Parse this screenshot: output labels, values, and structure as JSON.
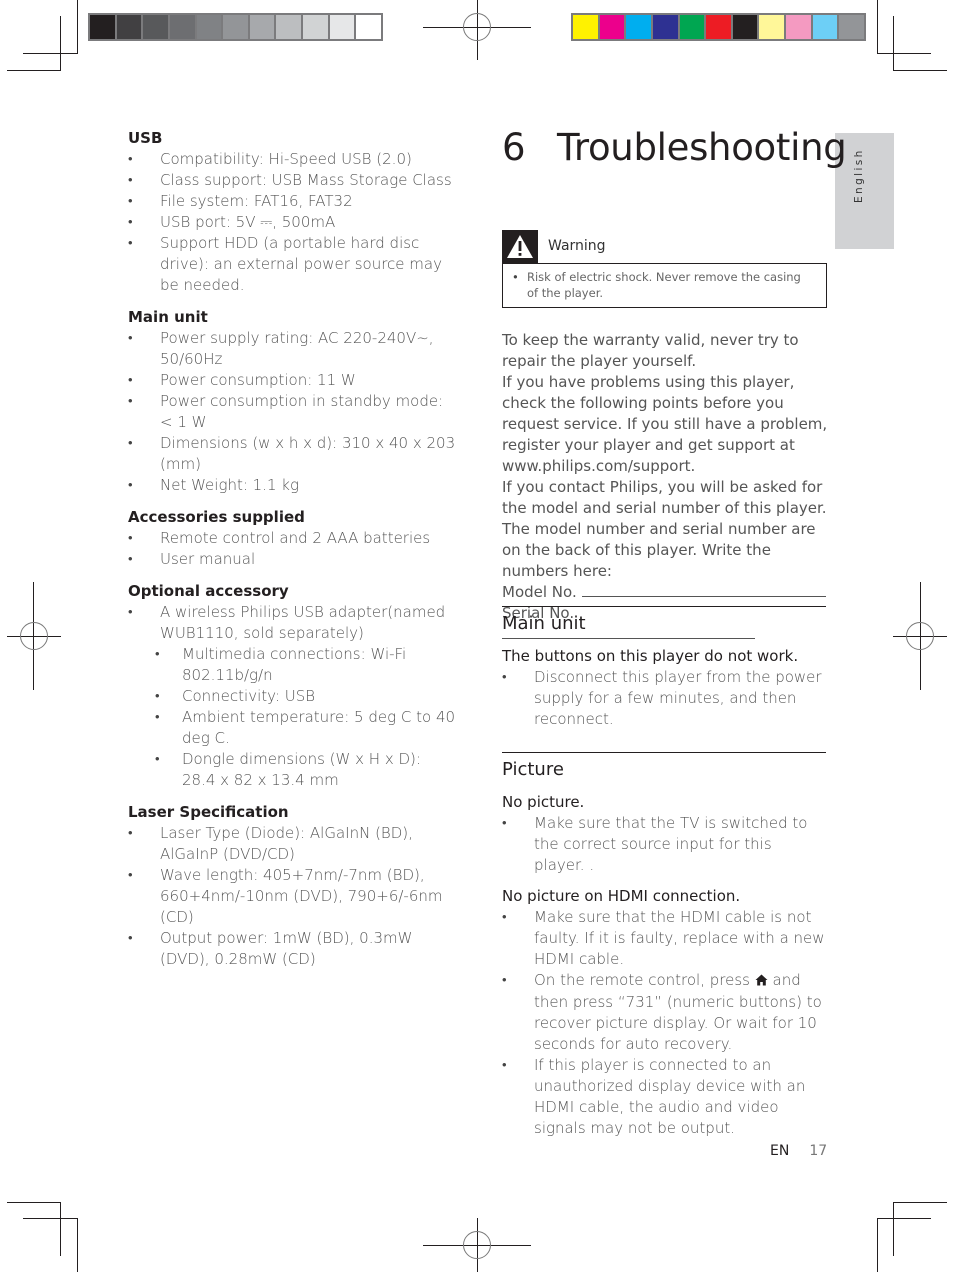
{
  "print_marks": {
    "gray_swatches": [
      "#231f20",
      "#414042",
      "#58595b",
      "#6d6e71",
      "#808285",
      "#939598",
      "#a7a9ac",
      "#bcbec0",
      "#d1d3d4",
      "#e6e7e8",
      "#ffffff"
    ],
    "color_swatches": [
      "#fff200",
      "#ec008c",
      "#00aeef",
      "#2e3192",
      "#00a651",
      "#ed1c24",
      "#231f20",
      "#fff799",
      "#f49ac1",
      "#6dcff6",
      "#939598"
    ]
  },
  "side_tab": {
    "label": "English"
  },
  "specs": {
    "usb": {
      "title": "USB",
      "items": [
        "Compatibility: Hi-Speed USB (2.0)",
        "Class support: USB Mass Storage Class",
        "File system: FAT16, FAT32",
        "USB port: 5V ⎓, 500mA",
        "Support HDD (a portable hard disc drive): an external power source may be needed."
      ]
    },
    "main_unit": {
      "title": "Main unit",
      "items": [
        "Power supply rating: AC 220-240V~, 50/60Hz",
        "Power consumption: 11 W",
        "Power consumption in standby mode: < 1 W",
        "Dimensions (w x h x d): 310 x 40 x 203 (mm)",
        "Net Weight: 1.1 kg"
      ]
    },
    "accessories": {
      "title": "Accessories supplied",
      "items": [
        "Remote control and 2 AAA batteries",
        "User manual"
      ]
    },
    "optional": {
      "title": "Optional accessory",
      "item": "A wireless Philips USB adapter(named WUB1110, sold separately)",
      "sub_items": [
        "Multimedia connections: Wi-Fi 802.11b/g/n",
        "Connectivity: USB",
        "Ambient temperature: 5 deg C to 40 deg C.",
        "Dongle dimensions (W x H x D): 28.4 x 82 x 13.4 mm"
      ]
    },
    "laser": {
      "title": "Laser Specification",
      "items": [
        "Laser Type (Diode): AlGaInN (BD), AlGaInP (DVD/CD)",
        "Wave length: 405+7nm/-7nm (BD), 660+4nm/-10nm (DVD), 790+6/-6nm (CD)",
        "Output power: 1mW (BD), 0.3mW (DVD), 0.28mW (CD)"
      ]
    }
  },
  "chapter": {
    "number": "6",
    "title": "Troubleshooting"
  },
  "warning": {
    "label": "Warning",
    "icon": "warning-triangle-icon",
    "text": "Risk of electric shock. Never remove the casing of the player."
  },
  "intro": {
    "p1": "To keep the warranty valid, never try to repair the player yourself.",
    "p2": "If you have problems using this player, check the following points before you request service. If you still have a problem, register your player and get support at www.philips.com/support.",
    "p3": "If you contact Philips, you will be asked for the model and serial number of this player. The model number and serial number are on the back of this player. Write the numbers here:",
    "model_label": "Model No.",
    "serial_label": "Serial No."
  },
  "troubleshooting": {
    "main_unit": {
      "title": "Main unit",
      "problem": "The buttons on this player do not work.",
      "solutions": [
        "Disconnect this player from the power supply for a few minutes, and then reconnect."
      ]
    },
    "picture": {
      "title": "Picture",
      "problems": [
        {
          "problem": "No picture.",
          "solutions": [
            "Make sure that the TV is switched to the correct source input for this player. ."
          ]
        },
        {
          "problem": "No picture on HDMI connection.",
          "solutions": [
            "Make sure that the HDMI cable is not faulty. If it is faulty, replace with a new HDMI cable.",
            "If this player is connected to an unauthorized display device with an HDMI cable, the audio and video signals may not be output."
          ],
          "remote_item": {
            "before": "On the remote control, press",
            "icon": "home-icon",
            "after": "and then press “731” (numeric buttons) to recover picture display. Or wait for 10 seconds for auto recovery."
          }
        }
      ]
    }
  },
  "footer": {
    "lang": "EN",
    "page": "17"
  }
}
